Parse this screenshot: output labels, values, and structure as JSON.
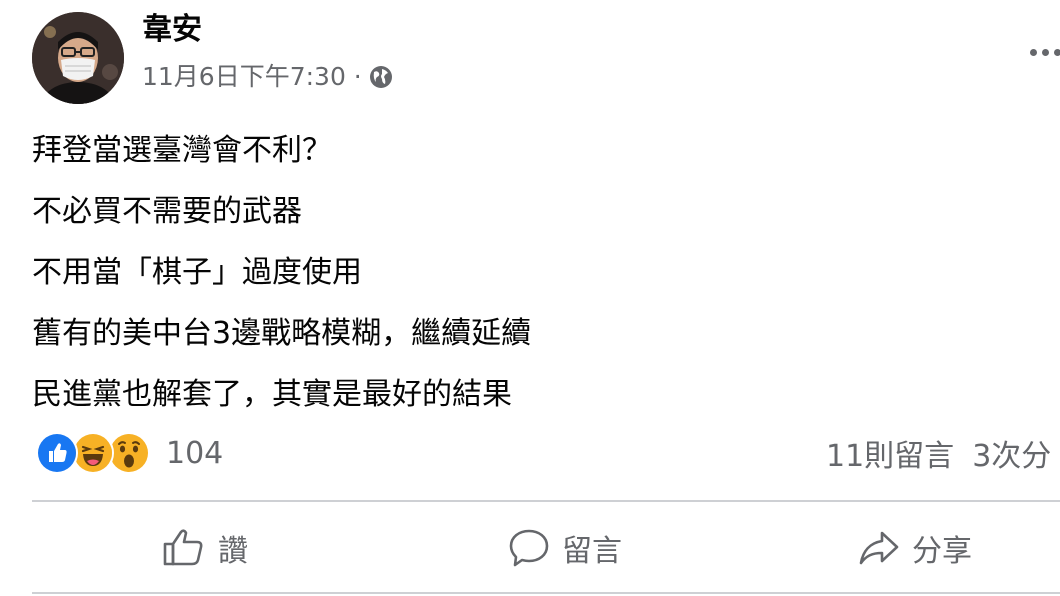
{
  "post": {
    "author": "韋安",
    "timestamp": "11月6日下午7:30 ·",
    "audience_icon": "globe-icon",
    "lines": [
      "拜登當選臺灣會不利？",
      "不必買不需要的武器",
      "不用當「棋子」過度使用",
      "舊有的美中台3邊戰略模糊，繼續延續",
      "民進黨也解套了，其實是最好的結果"
    ]
  },
  "reactions": {
    "types": [
      "like-icon",
      "haha-icon",
      "wow-icon"
    ],
    "count": "104"
  },
  "stats": {
    "comments": "11則留言",
    "shares": "3次分"
  },
  "actions": {
    "like": "讚",
    "comment": "留言",
    "share": "分享"
  },
  "colors": {
    "text": "#050505",
    "secondary": "#65676b",
    "like_blue": "#1877f2",
    "reaction_yellow": "#f7b125",
    "divider": "#ced0d4"
  }
}
